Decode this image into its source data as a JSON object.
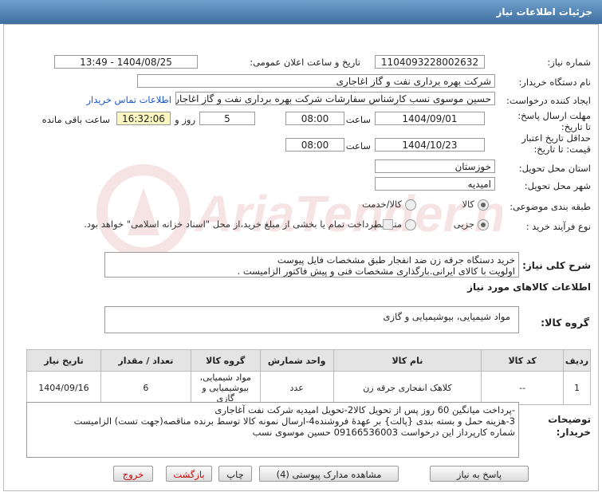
{
  "window": {
    "title": "جزئیات اطلاعات نیاز"
  },
  "form": {
    "need_number_label": "شماره نیاز:",
    "need_number": "1104093228002632",
    "announce_label": "تاریخ و ساعت اعلان عمومی:",
    "announce_value": "1404/08/25 - 13:49",
    "buyer_org_label": "نام دستگاه خریدار:",
    "buyer_org": "شرکت بهره برداری نفت و گاز اغاجاری",
    "creator_label": "ایجاد کننده درخواست:",
    "creator": "حسین موسوی نسب کارشناس سفارشات شرکت بهره برداری نفت و گاز اغاجار",
    "contact_link": "اطلاعات تماس خریدار",
    "deadline_label": "مهلت ارسال پاسخ: تا تاریخ:",
    "deadline_date": "1404/09/01",
    "time_label": "ساعت",
    "deadline_time": "08:00",
    "days_value": "5",
    "days_label": "روز و",
    "remaining_time": "16:32:06",
    "remaining_label": "ساعت باقی مانده",
    "validity_label": "حداقل تاریخ اعتبار قیمت: تا تاریخ:",
    "validity_date": "1404/10/23",
    "validity_time": "08:00",
    "province_label": "استان محل تحویل:",
    "province": "خوزستان",
    "city_label": "شهر محل تحویل:",
    "city": "امیدیه",
    "category_label": "طبقه بندی موضوعی:",
    "category_options": [
      "کالا",
      "کالا/خدمت"
    ],
    "category_selected": "کالا",
    "process_label": "نوع فرآیند خرید :",
    "process_options": [
      "جزیی",
      "متوسط"
    ],
    "process_selected": "جزیی",
    "payment_note": "پرداخت تمام یا بخشی از مبلغ خرید،از محل \"اسناد خزانه اسلامی\" خواهد بود."
  },
  "watermark": {
    "text": "AriaTender.net"
  },
  "summary": {
    "label": "شرح کلی نیاز:",
    "line1": "خرید دستگاه جرقه زن  ضد انفجار طبق مشخصات فایل پیوست",
    "line2": "اولویت با کالای ایرانی.بارگذاری مشخصات فنی و پیش فاکتور الزامیست ."
  },
  "goods_section": {
    "title": "اطلاعات کالاهای مورد نیاز",
    "group_label": "گروه کالا:",
    "group_value": "مواد شیمیایی، بیوشیمیایی و  گازی"
  },
  "table": {
    "headers": [
      "ردیف",
      "کد کالا",
      "نام کالا",
      "واحد شمارش",
      "گروه کالا",
      "تعداد / مقدار",
      "تاریخ نیاز"
    ],
    "rows": [
      [
        "1",
        "--",
        "کلاهک انفجاری جرقه زن",
        "عدد",
        "مواد شیمیایی، بیوشیمیایی و گازی",
        "6",
        "1404/09/16"
      ]
    ]
  },
  "buyer_notes": {
    "label": "توضیحات خریدار:",
    "line1": "-پرداخت میانگین 60 روز پس از تحویل کالا2-تحویل امیدیه شرکت نفت آغاجاری",
    "line2": "3-هزینه حمل  و بسته بندی {پالت} بر عهدۀ فروشنده4-ارسال نمونه کالا توسط برنده مناقصه(جهت تست) الزامیست",
    "line3": "شماره کارپرداز این درخواست 09166536003 حسین موسوی نسب"
  },
  "buttons": {
    "reply": "پاسخ به نیاز",
    "attachments": "مشاهده مدارک پیوستی (4)",
    "print": "چاپ",
    "back": "بازگشت",
    "exit": "خروج"
  }
}
